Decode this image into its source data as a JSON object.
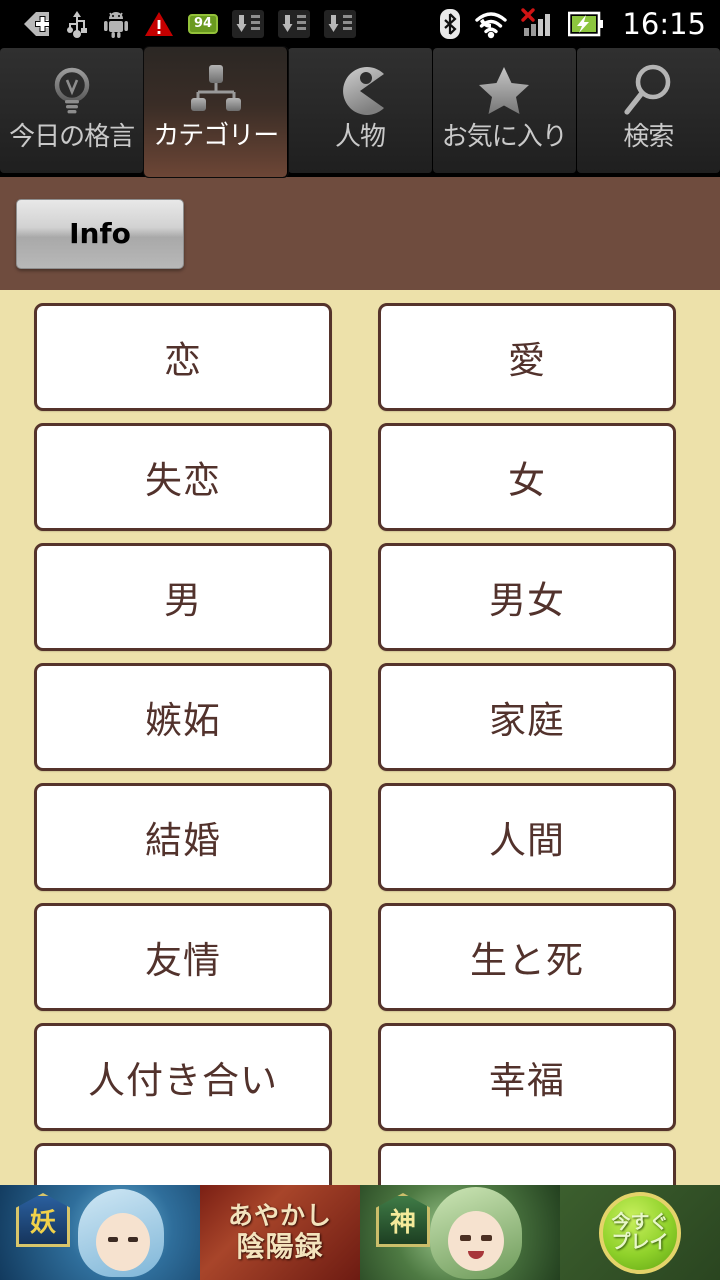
{
  "status_bar": {
    "time": "16:15",
    "battery_level": "94",
    "icons": [
      {
        "name": "app-shortcut-icon",
        "glyph": "✙"
      },
      {
        "name": "usb-icon",
        "glyph": "↑"
      },
      {
        "name": "android-robot-icon",
        "glyph": "▢"
      },
      {
        "name": "warning-triangle-icon",
        "glyph": "⚠"
      },
      {
        "name": "battery-level-icon",
        "glyph": "94"
      },
      {
        "name": "download-icon-1",
        "glyph": "⬇"
      },
      {
        "name": "download-icon-2",
        "glyph": "⬇"
      },
      {
        "name": "download-icon-3",
        "glyph": "⬇"
      },
      {
        "name": "bluetooth-icon",
        "glyph": "ᛦ"
      },
      {
        "name": "wifi-icon",
        "glyph": "◠"
      },
      {
        "name": "cellular-signal-icon",
        "glyph": "▐"
      },
      {
        "name": "battery-charging-icon",
        "glyph": "⚡"
      }
    ],
    "colors": {
      "background": "#000000",
      "text": "#ffffff",
      "battery_green": "#6a9a1f",
      "warning_red": "#c00000"
    }
  },
  "tabs": [
    {
      "label": "今日の格言",
      "icon": "lightbulb-icon",
      "active": false
    },
    {
      "label": "カテゴリー",
      "icon": "hierarchy-icon",
      "active": true
    },
    {
      "label": "人物",
      "icon": "person-pac-icon",
      "active": false
    },
    {
      "label": "お気に入り",
      "icon": "star-icon",
      "active": false
    },
    {
      "label": "検索",
      "icon": "search-icon",
      "active": false
    }
  ],
  "action_bar": {
    "info_label": "Info",
    "background_color": "#6f4c3e"
  },
  "categories": [
    "恋",
    "愛",
    "失恋",
    "女",
    "男",
    "男女",
    "嫉妬",
    "家庭",
    "結婚",
    "人間",
    "友情",
    "生と死",
    "人付き合い",
    "幸福",
    "",
    ""
  ],
  "theme": {
    "content_background": "#ede1aa",
    "button_background": "#ffffff",
    "button_border": "#55332b",
    "button_text": "#52322c",
    "header_brown": "#6f4c3e",
    "tab_active_brown": "#6d4636"
  },
  "ad_banner": {
    "title_line1": "あやかし",
    "title_line2": "陰陽録",
    "badge_left": "妖",
    "badge_right": "神",
    "cta_line1": "今すぐ",
    "cta_line2": "プレイ"
  }
}
